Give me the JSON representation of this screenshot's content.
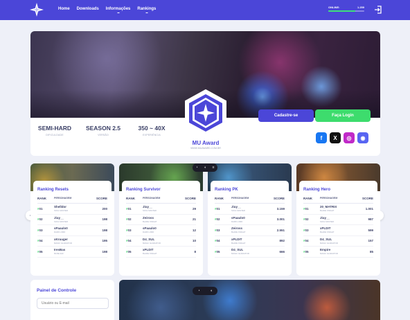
{
  "nav": {
    "links": [
      "Home",
      "Downloads",
      "Informações",
      "Rankings"
    ],
    "online_label": "ONLINE:",
    "online_count": "1.259",
    "online_fill_fraction": 0.75
  },
  "hero": {
    "stats": [
      {
        "value": "SEMI-HARD",
        "label": "DIFICULDADE"
      },
      {
        "value": "SEASON 2.5",
        "label": "VERSÃO"
      },
      {
        "value": "350 ~ 40X",
        "label": "EXPERIÊNCIA"
      }
    ],
    "title": "MU Award",
    "url": "WWW.MUAWARD.COM.BR",
    "register_label": "Cadastre-se",
    "login_label": "Faça Login",
    "socials": [
      {
        "icon": "facebook-icon",
        "glyph": "f",
        "color": "#1877f2"
      },
      {
        "icon": "x-icon",
        "glyph": "X",
        "color": "#111111"
      },
      {
        "icon": "instagram-icon",
        "glyph": "◎",
        "color": "#c02ac8"
      },
      {
        "icon": "discord-icon",
        "glyph": "◉",
        "color": "#5865f2"
      }
    ]
  },
  "rankings": [
    {
      "title": "Ranking Resets",
      "headers": [
        "RANK",
        "PERSONAGEM",
        "SCORE"
      ],
      "rows": [
        {
          "rank": "01",
          "name": "Shelldor",
          "class": "SOUL MASTER",
          "score": "200"
        },
        {
          "rank": "02",
          "name": "Jiuy__",
          "class": "SOUL MASTER",
          "score": "198"
        },
        {
          "rank": "03",
          "name": "sPaaulo0",
          "class": "DARK LORD",
          "score": "198"
        },
        {
          "rank": "04",
          "name": "xKruuger",
          "class": "MAGIC GLADIATOR",
          "score": "195"
        },
        {
          "rank": "05",
          "name": "IresBas",
          "class": "MUSE ELF",
          "score": "198"
        }
      ]
    },
    {
      "title": "Ranking Survivor",
      "headers": [
        "RANK",
        "PERSONAGEM",
        "SCORE"
      ],
      "rows": [
        {
          "rank": "01",
          "name": "Jiuy__",
          "class": "SOUL MASTER",
          "score": "29"
        },
        {
          "rank": "02",
          "name": "Zeiross",
          "class": "BLADE KNIGHT",
          "score": "21"
        },
        {
          "rank": "03",
          "name": "sPaaulo0",
          "class": "DARK LORD",
          "score": "12"
        },
        {
          "rank": "04",
          "name": "D4_SUL",
          "class": "MAGIC GLADIATOR",
          "score": "10"
        },
        {
          "rank": "05",
          "name": "xPLDIT",
          "class": "BLADE KNIGHT",
          "score": "8"
        }
      ]
    },
    {
      "title": "Ranking PK",
      "headers": [
        "RANK",
        "PERSONAGEM",
        "SCORE"
      ],
      "rows": [
        {
          "rank": "01",
          "name": "Jiuy__",
          "class": "SOUL MASTER",
          "score": "3.159"
        },
        {
          "rank": "02",
          "name": "sPaaulo0",
          "class": "DARK LORD",
          "score": "3.001"
        },
        {
          "rank": "03",
          "name": "Zeiross",
          "class": "BLADE KNIGHT",
          "score": "2.551"
        },
        {
          "rank": "04",
          "name": "xPLDIT",
          "class": "BLADE KNIGHT",
          "score": "892"
        },
        {
          "rank": "05",
          "name": "D4_SUL",
          "class": "MAGIC GLADIATOR",
          "score": "666"
        }
      ]
    },
    {
      "title": "Ranking Hero",
      "headers": [
        "RANK",
        "PERSONAGEM",
        "SCORE"
      ],
      "rows": [
        {
          "rank": "01",
          "name": "20_MATRIX",
          "class": "BLADE KNIGHT",
          "score": "1.001"
        },
        {
          "rank": "02",
          "name": "Jiuy__",
          "class": "SOUL MASTER",
          "score": "987"
        },
        {
          "rank": "03",
          "name": "xPLDIT",
          "class": "BLADE KNIGHT",
          "score": "599"
        },
        {
          "rank": "04",
          "name": "D4_SUL",
          "class": "MAGIC GLADIATOR",
          "score": "157"
        },
        {
          "rank": "05",
          "name": "Empire",
          "class": "MAGIC GLADIATOR",
          "score": "85"
        }
      ]
    }
  ],
  "panel": {
    "title": "Painel de Controle",
    "login_placeholder": "Usuário ou E-mail"
  },
  "colors": {
    "accent": "#4b46d8",
    "success": "#3ddc6d",
    "background": "#eef0f8"
  }
}
